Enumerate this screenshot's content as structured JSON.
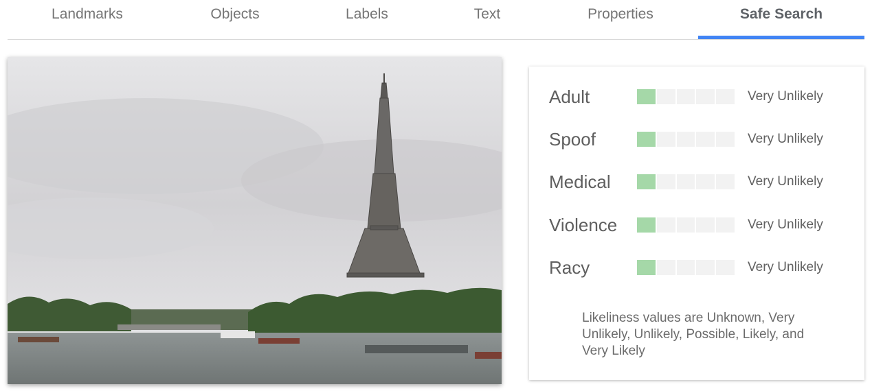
{
  "tabs": [
    {
      "label": "Landmarks",
      "active": false
    },
    {
      "label": "Objects",
      "active": false
    },
    {
      "label": "Labels",
      "active": false
    },
    {
      "label": "Text",
      "active": false
    },
    {
      "label": "Properties",
      "active": false
    },
    {
      "label": "Safe Search",
      "active": true
    }
  ],
  "colors": {
    "accent": "#4285f4",
    "meter_on": "#a5d8a8",
    "meter_off": "#f2f2f2"
  },
  "safe_search": {
    "rows": [
      {
        "label": "Adult",
        "value": "Very Unlikely",
        "level": 1,
        "max": 5
      },
      {
        "label": "Spoof",
        "value": "Very Unlikely",
        "level": 1,
        "max": 5
      },
      {
        "label": "Medical",
        "value": "Very Unlikely",
        "level": 1,
        "max": 5
      },
      {
        "label": "Violence",
        "value": "Very Unlikely",
        "level": 1,
        "max": 5
      },
      {
        "label": "Racy",
        "value": "Very Unlikely",
        "level": 1,
        "max": 5
      }
    ],
    "note": "Likeliness values are Unknown, Very Unlikely, Unlikely, Possible, Likely, and Very Likely"
  }
}
